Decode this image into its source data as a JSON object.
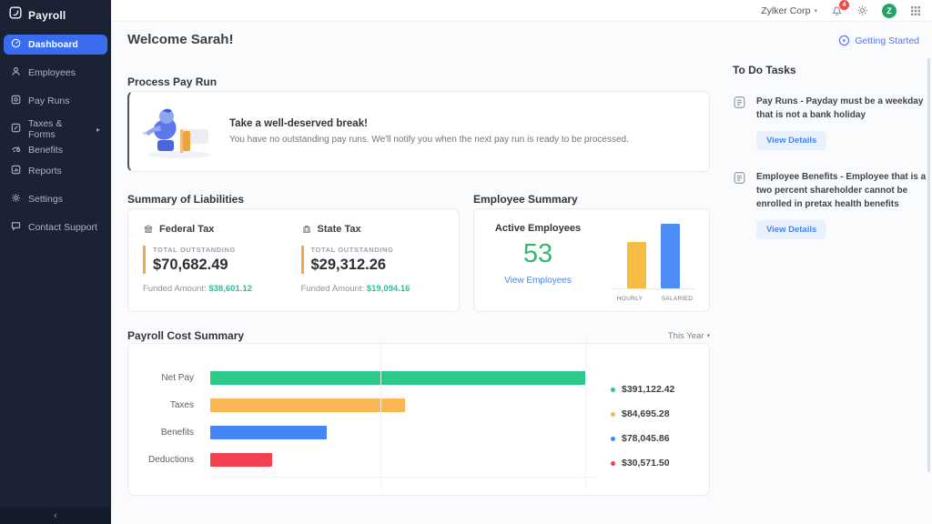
{
  "glyphs": {
    "caret_down": "▾",
    "chevron_right": "▸",
    "chevron_left": "‹"
  },
  "colors": {
    "sidebar_bg": "#1a2233",
    "active_item": "#3a6cf0",
    "accent_orange": "#f2a64e",
    "funded_green": "#2fbf9a",
    "count_green": "#34b871",
    "link_blue": "#4a86f2",
    "getting_started_blue": "#5b74ee",
    "badge_red": "#ef4b4b",
    "avatar_green": "#21a565"
  },
  "sidebar": {
    "logo": "Payroll",
    "items": [
      {
        "label": "Dashboard",
        "active": true
      },
      {
        "label": "Employees"
      },
      {
        "label": "Pay Runs"
      },
      {
        "label": "Taxes & Forms",
        "has_submenu": true
      },
      {
        "label": "Benefits"
      },
      {
        "label": "Reports"
      },
      {
        "label": "Settings"
      },
      {
        "label": "Contact Support"
      }
    ]
  },
  "topbar": {
    "org_name": "Zylker Corp",
    "notification_count": "4",
    "avatar_initial": "Z"
  },
  "header": {
    "welcome": "Welcome Sarah!",
    "getting_started": "Getting Started"
  },
  "process_pay_run": {
    "section_title": "Process Pay Run",
    "title": "Take a well-deserved break!",
    "subtitle": "You have no outstanding pay runs. We'll notify you when the next pay run is ready to be processed."
  },
  "liabilities": {
    "section_title": "Summary of Liabilities",
    "items": [
      {
        "name": "Federal Tax",
        "outstanding_label": "TOTAL OUTSTANDING",
        "outstanding": "$70,682.49",
        "funded_label": "Funded Amount:",
        "funded": "$38,601.12"
      },
      {
        "name": "State Tax",
        "outstanding_label": "TOTAL OUTSTANDING",
        "outstanding": "$29,312.26",
        "funded_label": "Funded Amount:",
        "funded": "$19,094.16"
      }
    ]
  },
  "employee_summary": {
    "section_title": "Employee Summary",
    "active_label": "Active Employees",
    "active_count": "53",
    "view_link": "View Employees"
  },
  "payroll_cost": {
    "section_title": "Payroll Cost Summary",
    "filter_label": "This Year"
  },
  "todo": {
    "title": "To Do Tasks",
    "items": [
      {
        "text": "Pay Runs - Payday must be a weekday that is not a bank holiday",
        "button": "View Details"
      },
      {
        "text": "Employee Benefits - Employee that is a two percent shareholder cannot be enrolled in pretax health benefits",
        "button": "View Details"
      }
    ]
  },
  "chart_data": [
    {
      "type": "bar",
      "title": "Employee Summary",
      "categories": [
        "HOURLY",
        "SALARIED"
      ],
      "values": [
        22,
        31
      ],
      "note": "no numeric labels shown; values estimated from bar heights, total active employees = 53",
      "colors": [
        "#f6bc44",
        "#4e8df6"
      ],
      "bar_height_percent": [
        72,
        100
      ],
      "grid": false,
      "legend_position": "none"
    },
    {
      "type": "bar",
      "orientation": "horizontal",
      "title": "Payroll Cost Summary",
      "filter": "This Year",
      "categories": [
        "Net Pay",
        "Taxes",
        "Benefits",
        "Deductions"
      ],
      "values": [
        391122.42,
        84695.28,
        78045.86,
        30571.5
      ],
      "value_labels": [
        "$391,122.42",
        "$84,695.28",
        "$78,045.86",
        "$30,571.50"
      ],
      "colors": [
        "#2dc98b",
        "#f9b653",
        "#4486f5",
        "#f4414f"
      ],
      "bar_visual_percent": [
        100,
        52,
        31,
        16.5
      ],
      "grid": true,
      "legend_position": "right"
    }
  ]
}
